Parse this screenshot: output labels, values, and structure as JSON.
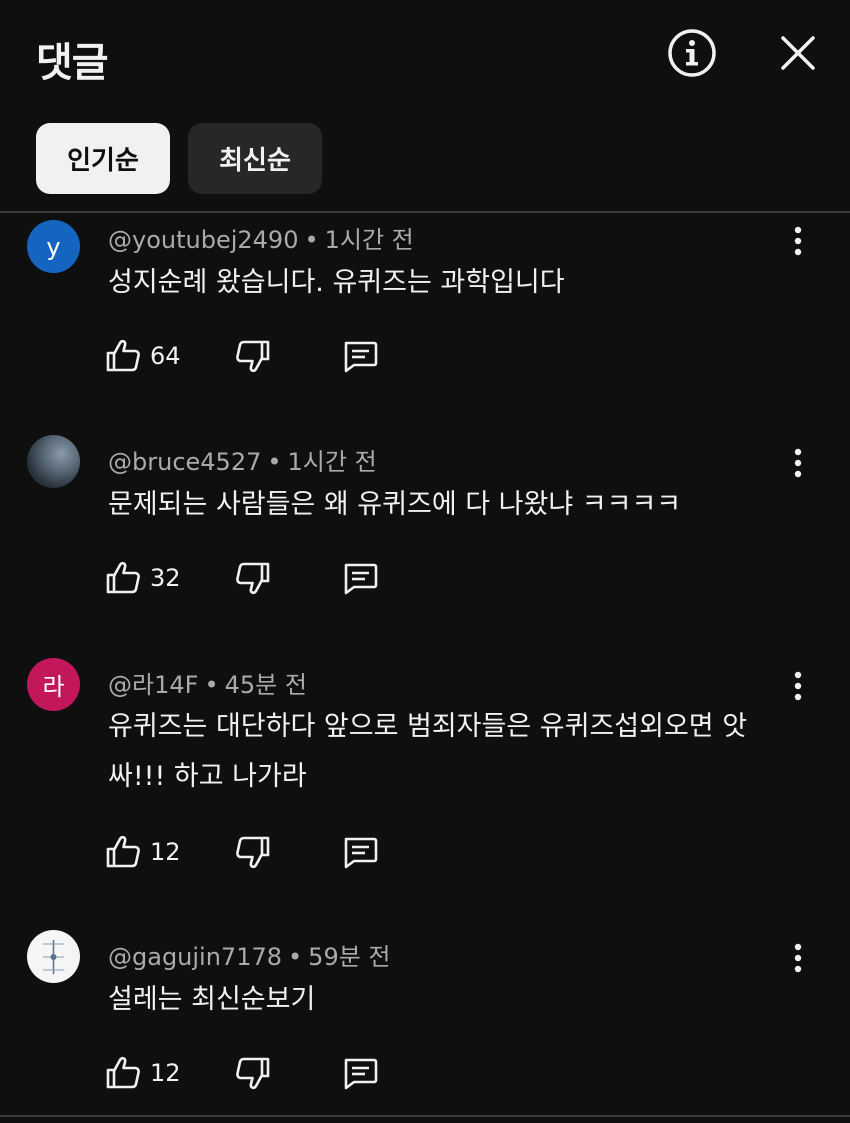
{
  "header": {
    "title": "댓글"
  },
  "sort_chips": [
    {
      "label": "인기순",
      "active": true
    },
    {
      "label": "최신순",
      "active": false
    }
  ],
  "comments": [
    {
      "avatar_letter": "y",
      "avatar_color": "#1565c0",
      "handle": "@youtubej2490",
      "time": "1시간 전",
      "text": "성지순례 왔습니다. 유퀴즈는 과학입니다",
      "likes": "64"
    },
    {
      "avatar_letter": "",
      "avatar_color": "#4a5560",
      "handle": "@bruce4527",
      "time": "1시간 전",
      "text": "문제되는 사람들은 왜 유퀴즈에 다 나왔냐 ㅋㅋㅋㅋ",
      "likes": "32"
    },
    {
      "avatar_letter": "라",
      "avatar_color": "#c2185b",
      "handle": "@라14F",
      "time": "45분 전",
      "text": "유퀴즈는 대단하다 앞으로 범죄자들은 유퀴즈섭외오면 앗싸!!! 하고 나가라",
      "likes": "12"
    },
    {
      "avatar_letter": "",
      "avatar_color": "#f5f5f5",
      "handle": "@gagujin7178",
      "time": "59분 전",
      "text": "설레는 최신순보기",
      "likes": "12"
    }
  ]
}
